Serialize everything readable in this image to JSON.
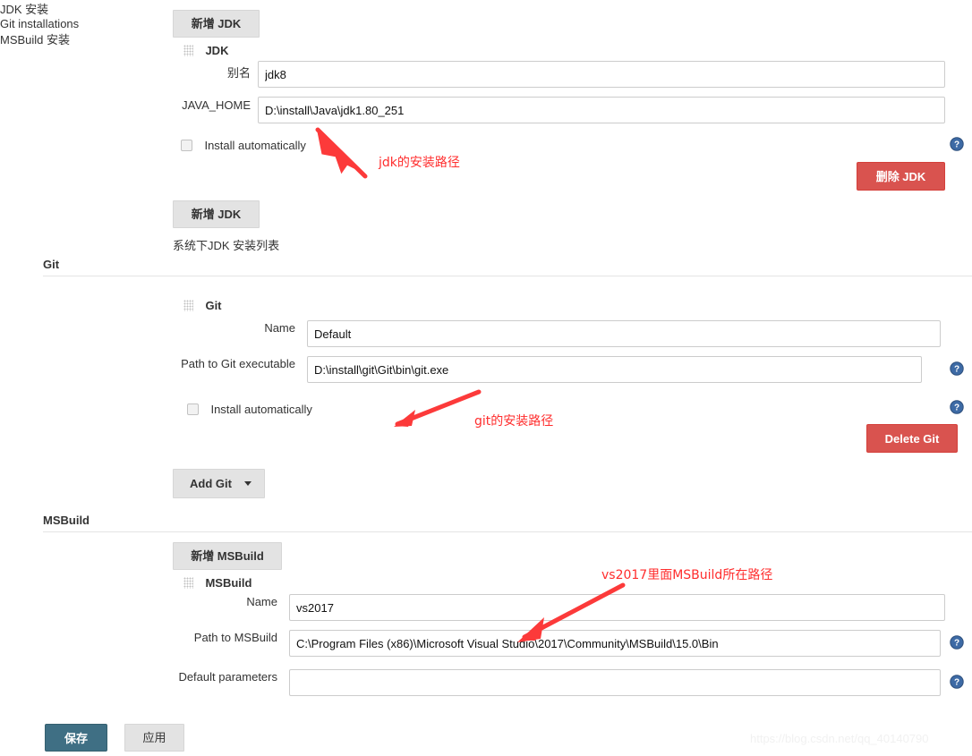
{
  "jdk_section": {
    "outer_label": "JDK 安装",
    "add_button_top": "新增 JDK",
    "item_title": "JDK",
    "alias_label": "别名",
    "alias_value": "jdk8",
    "java_home_label": "JAVA_HOME",
    "java_home_value": "D:\\install\\Java\\jdk1.80_251",
    "install_auto_label": "Install automatically",
    "delete_button": "删除 JDK",
    "add_button_bottom": "新增 JDK",
    "list_caption": "系统下JDK 安装列表"
  },
  "git_section": {
    "heading": "Git",
    "outer_label": "Git installations",
    "item_title": "Git",
    "name_label": "Name",
    "name_value": "Default",
    "path_label": "Path to Git executable",
    "path_value": "D:\\install\\git\\Git\\bin\\git.exe",
    "install_auto_label": "Install automatically",
    "delete_button": "Delete Git",
    "add_button": "Add Git"
  },
  "msbuild_section": {
    "heading": "MSBuild",
    "outer_label": "MSBuild 安装",
    "add_button": "新增 MSBuild",
    "item_title": "MSBuild",
    "name_label": "Name",
    "name_value": "vs2017",
    "path_label": "Path to MSBuild",
    "path_value": "C:\\Program Files (x86)\\Microsoft Visual Studio\\2017\\Community\\MSBuild\\15.0\\Bin",
    "default_params_label": "Default parameters",
    "default_params_value": ""
  },
  "footer": {
    "save_button": "保存",
    "apply_button": "应用",
    "watermark": "https://blog.csdn.net/qq_40140790"
  },
  "annotations": {
    "jdk": "jdk的安装路径",
    "git": "git的安装路径",
    "msbuild": "vs2017里面MSBuild所在路径"
  },
  "colors": {
    "danger": "#d9534f",
    "save": "#3f6f84",
    "annotation": "#ff2d2d",
    "help_icon": "#3d6aa5"
  }
}
